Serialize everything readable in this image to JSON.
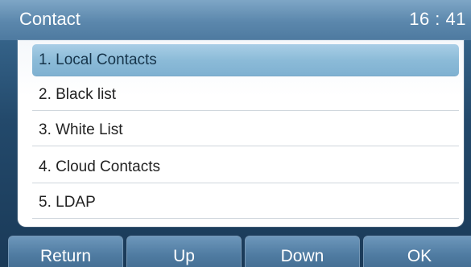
{
  "header": {
    "title": "Contact",
    "clock": "16 : 41"
  },
  "menu": {
    "selected_index": 0,
    "items": [
      {
        "label": "1. Local Contacts"
      },
      {
        "label": "2. Black list"
      },
      {
        "label": "3. White List"
      },
      {
        "label": "4. Cloud Contacts"
      },
      {
        "label": "5. LDAP"
      }
    ]
  },
  "softkeys": [
    {
      "label": "Return"
    },
    {
      "label": "Up"
    },
    {
      "label": "Down"
    },
    {
      "label": "OK"
    }
  ],
  "colors": {
    "title_bar": "#5b87ac",
    "selection": "#8cbbd8",
    "softkey": "#4f7ba1",
    "background": "#23496b"
  }
}
